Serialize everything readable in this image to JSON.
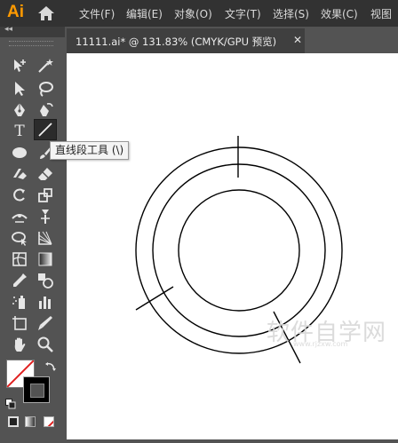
{
  "app": {
    "logo_text": "Ai"
  },
  "menu": [
    {
      "label": "文件(F)"
    },
    {
      "label": "编辑(E)"
    },
    {
      "label": "对象(O)"
    },
    {
      "label": "文字(T)"
    },
    {
      "label": "选择(S)"
    },
    {
      "label": "效果(C)"
    },
    {
      "label": "视图"
    }
  ],
  "panel": {
    "collapse_glyph": "◂◂"
  },
  "document_tab": {
    "title": "11111.ai* @ 131.83% (CMYK/GPU 预览)",
    "close_glyph": "✕"
  },
  "toolbar": {
    "type_tool_glyph": "T",
    "tooltip": "直线段工具 (\\)",
    "active_tool": "line-segment-tool"
  },
  "colors": {
    "fill": "#ffffff",
    "stroke": "#000000",
    "none_slash": "#e02020",
    "accent_logo": "#ff9a00"
  },
  "watermark": {
    "text": "软件自学网",
    "url": "www.rjzxw.com"
  }
}
